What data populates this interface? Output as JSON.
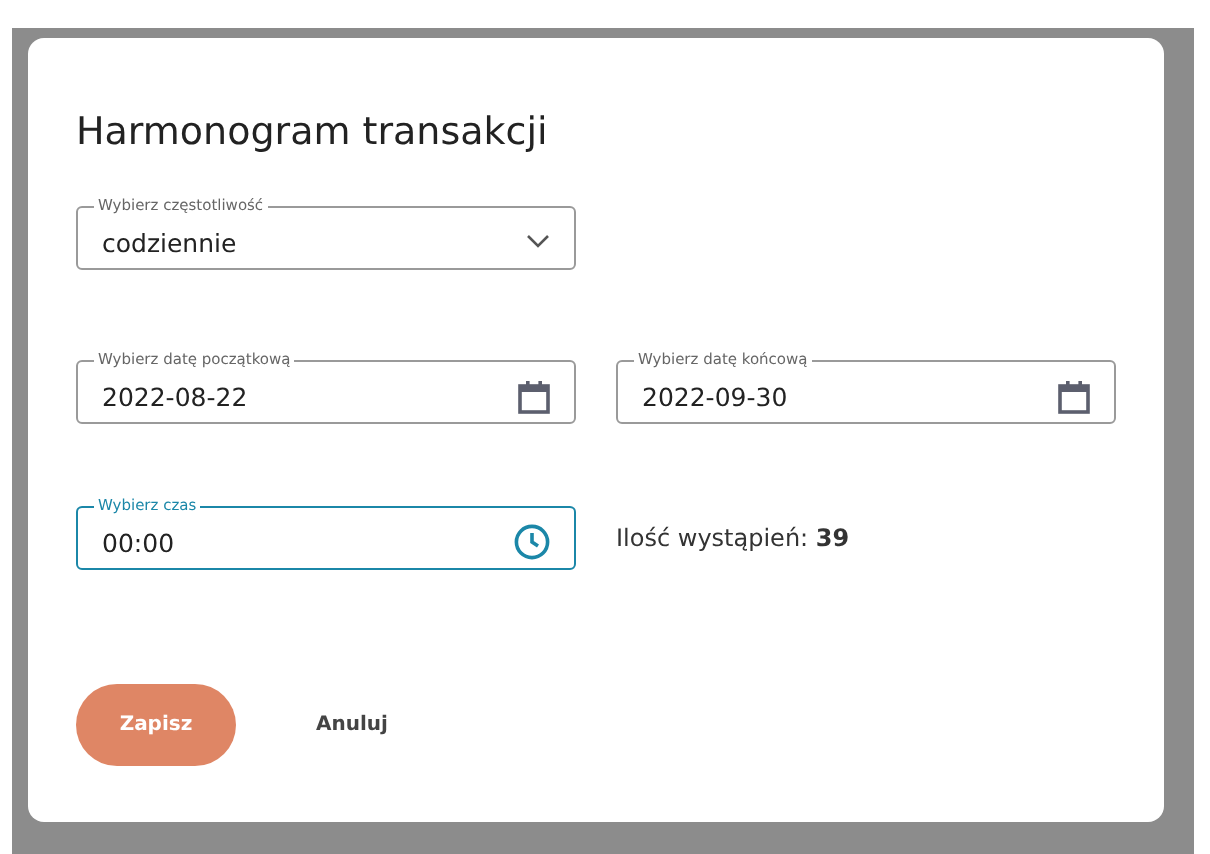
{
  "dialog": {
    "title": "Harmonogram transakcji",
    "frequency": {
      "label": "Wybierz częstotliwość",
      "value": "codziennie",
      "focused": false
    },
    "start_date": {
      "label": "Wybierz datę początkową",
      "value": "2022-08-22",
      "focused": false
    },
    "end_date": {
      "label": "Wybierz datę końcową",
      "value": "2022-09-30",
      "focused": false
    },
    "time": {
      "label": "Wybierz czas",
      "value": "00:00",
      "focused": true
    },
    "occurrences": {
      "label": "Ilość wystąpień:",
      "value": "39"
    },
    "buttons": [
      {
        "label": "Zapisz",
        "kind": "primary"
      },
      {
        "label": "Anuluj",
        "kind": "text"
      }
    ]
  }
}
